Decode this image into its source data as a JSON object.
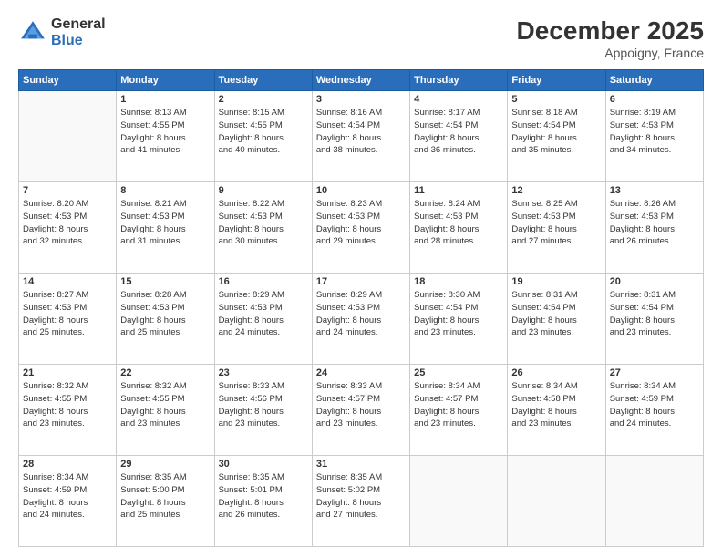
{
  "logo": {
    "general": "General",
    "blue": "Blue"
  },
  "header": {
    "month": "December 2025",
    "location": "Appoigny, France"
  },
  "weekdays": [
    "Sunday",
    "Monday",
    "Tuesday",
    "Wednesday",
    "Thursday",
    "Friday",
    "Saturday"
  ],
  "weeks": [
    [
      {
        "day": "",
        "empty": true
      },
      {
        "day": "1",
        "sunrise": "Sunrise: 8:13 AM",
        "sunset": "Sunset: 4:55 PM",
        "daylight": "Daylight: 8 hours and 41 minutes."
      },
      {
        "day": "2",
        "sunrise": "Sunrise: 8:15 AM",
        "sunset": "Sunset: 4:55 PM",
        "daylight": "Daylight: 8 hours and 40 minutes."
      },
      {
        "day": "3",
        "sunrise": "Sunrise: 8:16 AM",
        "sunset": "Sunset: 4:54 PM",
        "daylight": "Daylight: 8 hours and 38 minutes."
      },
      {
        "day": "4",
        "sunrise": "Sunrise: 8:17 AM",
        "sunset": "Sunset: 4:54 PM",
        "daylight": "Daylight: 8 hours and 36 minutes."
      },
      {
        "day": "5",
        "sunrise": "Sunrise: 8:18 AM",
        "sunset": "Sunset: 4:54 PM",
        "daylight": "Daylight: 8 hours and 35 minutes."
      },
      {
        "day": "6",
        "sunrise": "Sunrise: 8:19 AM",
        "sunset": "Sunset: 4:53 PM",
        "daylight": "Daylight: 8 hours and 34 minutes."
      }
    ],
    [
      {
        "day": "7",
        "sunrise": "Sunrise: 8:20 AM",
        "sunset": "Sunset: 4:53 PM",
        "daylight": "Daylight: 8 hours and 32 minutes."
      },
      {
        "day": "8",
        "sunrise": "Sunrise: 8:21 AM",
        "sunset": "Sunset: 4:53 PM",
        "daylight": "Daylight: 8 hours and 31 minutes."
      },
      {
        "day": "9",
        "sunrise": "Sunrise: 8:22 AM",
        "sunset": "Sunset: 4:53 PM",
        "daylight": "Daylight: 8 hours and 30 minutes."
      },
      {
        "day": "10",
        "sunrise": "Sunrise: 8:23 AM",
        "sunset": "Sunset: 4:53 PM",
        "daylight": "Daylight: 8 hours and 29 minutes."
      },
      {
        "day": "11",
        "sunrise": "Sunrise: 8:24 AM",
        "sunset": "Sunset: 4:53 PM",
        "daylight": "Daylight: 8 hours and 28 minutes."
      },
      {
        "day": "12",
        "sunrise": "Sunrise: 8:25 AM",
        "sunset": "Sunset: 4:53 PM",
        "daylight": "Daylight: 8 hours and 27 minutes."
      },
      {
        "day": "13",
        "sunrise": "Sunrise: 8:26 AM",
        "sunset": "Sunset: 4:53 PM",
        "daylight": "Daylight: 8 hours and 26 minutes."
      }
    ],
    [
      {
        "day": "14",
        "sunrise": "Sunrise: 8:27 AM",
        "sunset": "Sunset: 4:53 PM",
        "daylight": "Daylight: 8 hours and 25 minutes."
      },
      {
        "day": "15",
        "sunrise": "Sunrise: 8:28 AM",
        "sunset": "Sunset: 4:53 PM",
        "daylight": "Daylight: 8 hours and 25 minutes."
      },
      {
        "day": "16",
        "sunrise": "Sunrise: 8:29 AM",
        "sunset": "Sunset: 4:53 PM",
        "daylight": "Daylight: 8 hours and 24 minutes."
      },
      {
        "day": "17",
        "sunrise": "Sunrise: 8:29 AM",
        "sunset": "Sunset: 4:53 PM",
        "daylight": "Daylight: 8 hours and 24 minutes."
      },
      {
        "day": "18",
        "sunrise": "Sunrise: 8:30 AM",
        "sunset": "Sunset: 4:54 PM",
        "daylight": "Daylight: 8 hours and 23 minutes."
      },
      {
        "day": "19",
        "sunrise": "Sunrise: 8:31 AM",
        "sunset": "Sunset: 4:54 PM",
        "daylight": "Daylight: 8 hours and 23 minutes."
      },
      {
        "day": "20",
        "sunrise": "Sunrise: 8:31 AM",
        "sunset": "Sunset: 4:54 PM",
        "daylight": "Daylight: 8 hours and 23 minutes."
      }
    ],
    [
      {
        "day": "21",
        "sunrise": "Sunrise: 8:32 AM",
        "sunset": "Sunset: 4:55 PM",
        "daylight": "Daylight: 8 hours and 23 minutes."
      },
      {
        "day": "22",
        "sunrise": "Sunrise: 8:32 AM",
        "sunset": "Sunset: 4:55 PM",
        "daylight": "Daylight: 8 hours and 23 minutes."
      },
      {
        "day": "23",
        "sunrise": "Sunrise: 8:33 AM",
        "sunset": "Sunset: 4:56 PM",
        "daylight": "Daylight: 8 hours and 23 minutes."
      },
      {
        "day": "24",
        "sunrise": "Sunrise: 8:33 AM",
        "sunset": "Sunset: 4:57 PM",
        "daylight": "Daylight: 8 hours and 23 minutes."
      },
      {
        "day": "25",
        "sunrise": "Sunrise: 8:34 AM",
        "sunset": "Sunset: 4:57 PM",
        "daylight": "Daylight: 8 hours and 23 minutes."
      },
      {
        "day": "26",
        "sunrise": "Sunrise: 8:34 AM",
        "sunset": "Sunset: 4:58 PM",
        "daylight": "Daylight: 8 hours and 23 minutes."
      },
      {
        "day": "27",
        "sunrise": "Sunrise: 8:34 AM",
        "sunset": "Sunset: 4:59 PM",
        "daylight": "Daylight: 8 hours and 24 minutes."
      }
    ],
    [
      {
        "day": "28",
        "sunrise": "Sunrise: 8:34 AM",
        "sunset": "Sunset: 4:59 PM",
        "daylight": "Daylight: 8 hours and 24 minutes."
      },
      {
        "day": "29",
        "sunrise": "Sunrise: 8:35 AM",
        "sunset": "Sunset: 5:00 PM",
        "daylight": "Daylight: 8 hours and 25 minutes."
      },
      {
        "day": "30",
        "sunrise": "Sunrise: 8:35 AM",
        "sunset": "Sunset: 5:01 PM",
        "daylight": "Daylight: 8 hours and 26 minutes."
      },
      {
        "day": "31",
        "sunrise": "Sunrise: 8:35 AM",
        "sunset": "Sunset: 5:02 PM",
        "daylight": "Daylight: 8 hours and 27 minutes."
      },
      {
        "day": "",
        "empty": true
      },
      {
        "day": "",
        "empty": true
      },
      {
        "day": "",
        "empty": true
      }
    ]
  ]
}
